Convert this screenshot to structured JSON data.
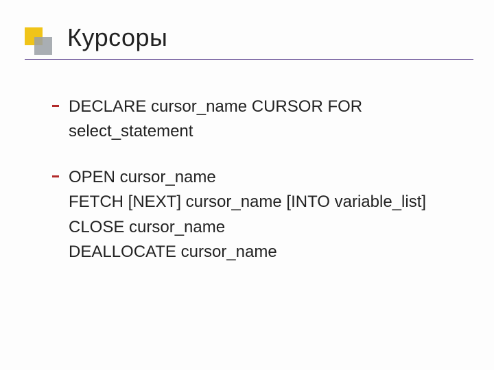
{
  "title": "Курсоры",
  "blocks": [
    {
      "lines": [
        "DECLARE cursor_name CURSOR FOR",
        "select_statement"
      ],
      "bullet": true
    },
    {
      "lines": [
        "OPEN cursor_name",
        "FETCH [NEXT] cursor_name [INTO variable_list]",
        "CLOSE cursor_name",
        "DEALLOCATE cursor_name"
      ],
      "bullet": true
    }
  ]
}
